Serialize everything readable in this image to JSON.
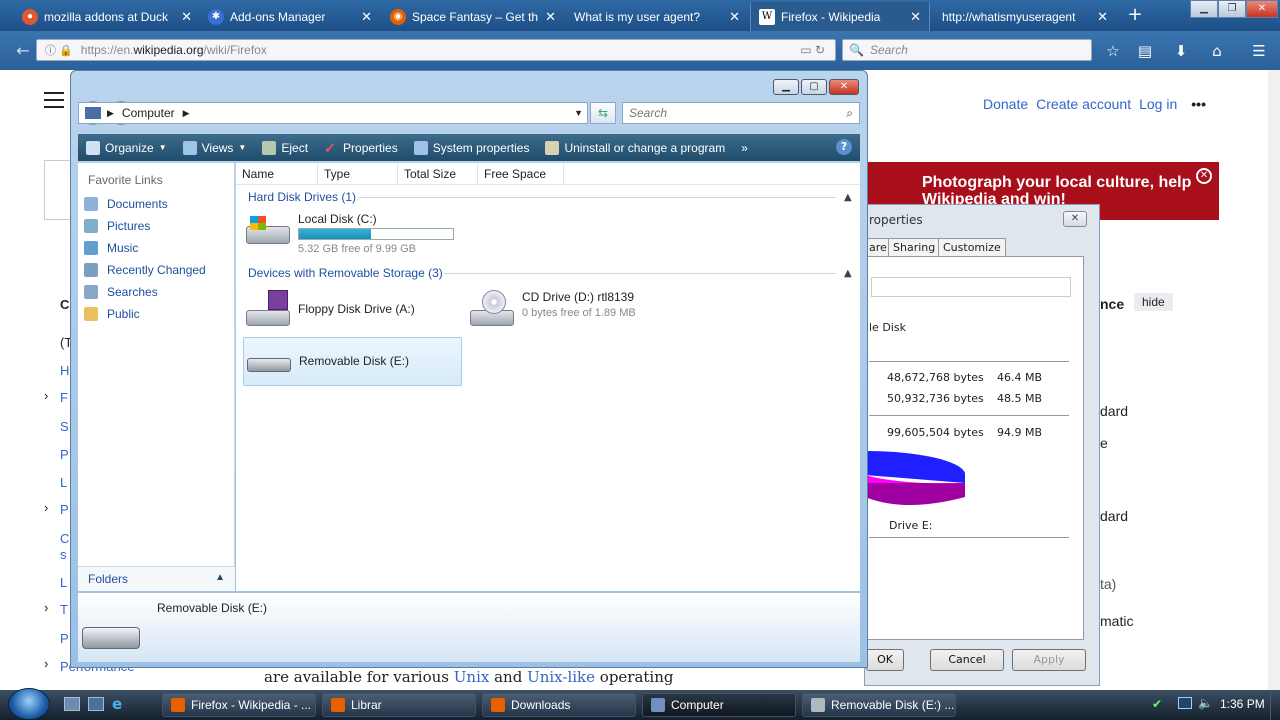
{
  "browser": {
    "tabs": [
      {
        "label": "mozilla addons at Duck",
        "icon": "duckduckgo-icon",
        "color": "#de5833"
      },
      {
        "label": "Add-ons Manager",
        "icon": "puzzle-icon",
        "color": "#3a6fd4"
      },
      {
        "label": "Space Fantasy – Get th",
        "icon": "firefox-icon",
        "color": "#e66000"
      },
      {
        "label": "What is my user agent?",
        "icon": "",
        "color": ""
      },
      {
        "label": "Firefox - Wikipedia",
        "icon": "wikipedia-icon",
        "color": "#ffffff"
      },
      {
        "label": "http://whatismyuseragent",
        "icon": "",
        "color": ""
      }
    ],
    "url_prefix": "https://en.",
    "url_domain": "wikipedia.org",
    "url_path": "/wiki/Firefox",
    "search_placeholder": "Search"
  },
  "wikipedia": {
    "top_links": [
      "Donate",
      "Create account",
      "Log in"
    ],
    "banner_text": "Photograph your local culture, help Wikipedia and win!",
    "bottom_text_before": "are available for various ",
    "bottom_link1": "Unix",
    "bottom_text_mid": " and ",
    "bottom_link2": "Unix-like",
    "bottom_text_after": " operating",
    "right_fragments": [
      "nce",
      "hide",
      "dard",
      "e",
      "dard",
      "ta)",
      "matic"
    ],
    "left_fragments": [
      "C",
      "(T",
      "H",
      "F",
      "S",
      "P",
      "L",
      "P",
      "C",
      "s",
      "L",
      "T",
      "P",
      "Performance"
    ]
  },
  "properties_dialog": {
    "title": "roperties",
    "tabs": [
      "are",
      "Sharing",
      "Customize"
    ],
    "type_label": "le Disk",
    "used_bytes": "48,672,768 bytes",
    "used_mb": "46.4 MB",
    "free_bytes": "50,932,736 bytes",
    "free_mb": "48.5 MB",
    "capacity_bytes": "99,605,504 bytes",
    "capacity_mb": "94.9 MB",
    "drive_label": "Drive E:",
    "buttons": [
      "OK",
      "Cancel",
      "Apply"
    ],
    "used_color": "#1f1fff",
    "free_color": "#ff00ff"
  },
  "explorer": {
    "breadcrumb": "Computer",
    "search_placeholder": "Search",
    "toolbar": [
      "Organize",
      "Views",
      "Eject",
      "Properties",
      "System properties",
      "Uninstall or change a program"
    ],
    "favorite_links_header": "Favorite Links",
    "favorite_links": [
      "Documents",
      "Pictures",
      "Music",
      "Recently Changed",
      "Searches",
      "Public"
    ],
    "folders_label": "Folders",
    "columns": [
      "Name",
      "Type",
      "Total Size",
      "Free Space"
    ],
    "groups": [
      {
        "title": "Hard Disk Drives (1)"
      },
      {
        "title": "Devices with Removable Storage (3)"
      }
    ],
    "local_disk": {
      "name": "Local Disk (C:)",
      "free": "5.32 GB free of 9.99 GB",
      "used_fraction": 0.47
    },
    "floppy": {
      "name": "Floppy Disk Drive (A:)"
    },
    "cd": {
      "name": "CD Drive (D:) rtl8139",
      "free": "0 bytes free of 1.89 MB"
    },
    "removable": {
      "name": "Removable Disk (E:)"
    },
    "details_name": "Removable Disk (E:)"
  },
  "taskbar": {
    "items": [
      "Firefox - Wikipedia - ...",
      "Librar",
      "Downloads",
      "Computer",
      "Removable Disk (E:) ..."
    ],
    "clock": "1:36 PM"
  }
}
